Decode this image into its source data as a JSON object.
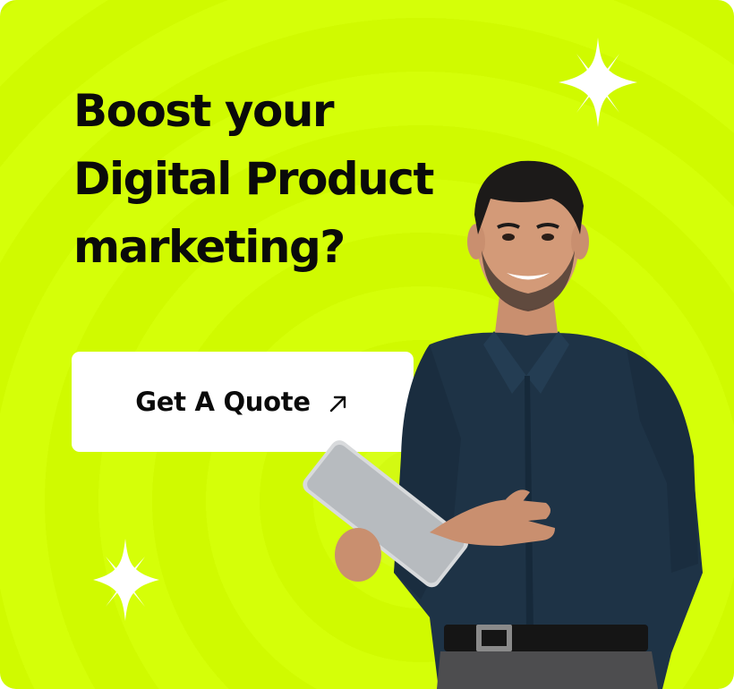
{
  "banner": {
    "headline_lines": [
      "Boost your",
      "Digital Product",
      "marketing?"
    ],
    "cta_label": "Get A Quote",
    "cta_icon": "arrow-up-right-icon",
    "decor_icon": "sparkle-icon",
    "photo": "smiling-man-with-tablet"
  },
  "colors": {
    "background": "#d4ff00",
    "text": "#0a0a0a",
    "button": "#ffffff",
    "sparkle": "#ffffff"
  }
}
